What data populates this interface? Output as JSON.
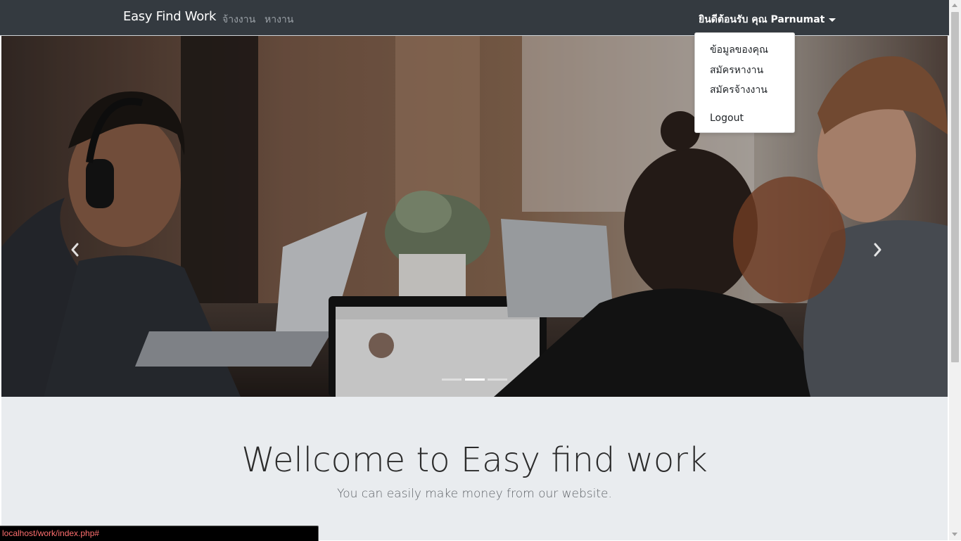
{
  "navbar": {
    "brand": "Easy Find Work",
    "links": [
      "จ้างงาน",
      "หางาน"
    ],
    "user_menu_label": "ยินดีต้อนรับ คุณ Parnumat"
  },
  "user_dropdown": {
    "items": [
      "ข้อมูลของคุณ",
      "สมัครหางาน",
      "สมัครจ้างงาน",
      "Logout"
    ]
  },
  "carousel": {
    "slide_count": 3,
    "active_slide": 2
  },
  "jumbotron": {
    "title": "Wellcome to Easy find work",
    "subtitle": "You can easily make money from our website."
  },
  "status_bar": {
    "url": "localhost/work/index.php#"
  },
  "colors": {
    "navbar_bg": "#343a40",
    "jumbotron_bg": "#e9ecef",
    "status_text": "#ff6f6f"
  }
}
